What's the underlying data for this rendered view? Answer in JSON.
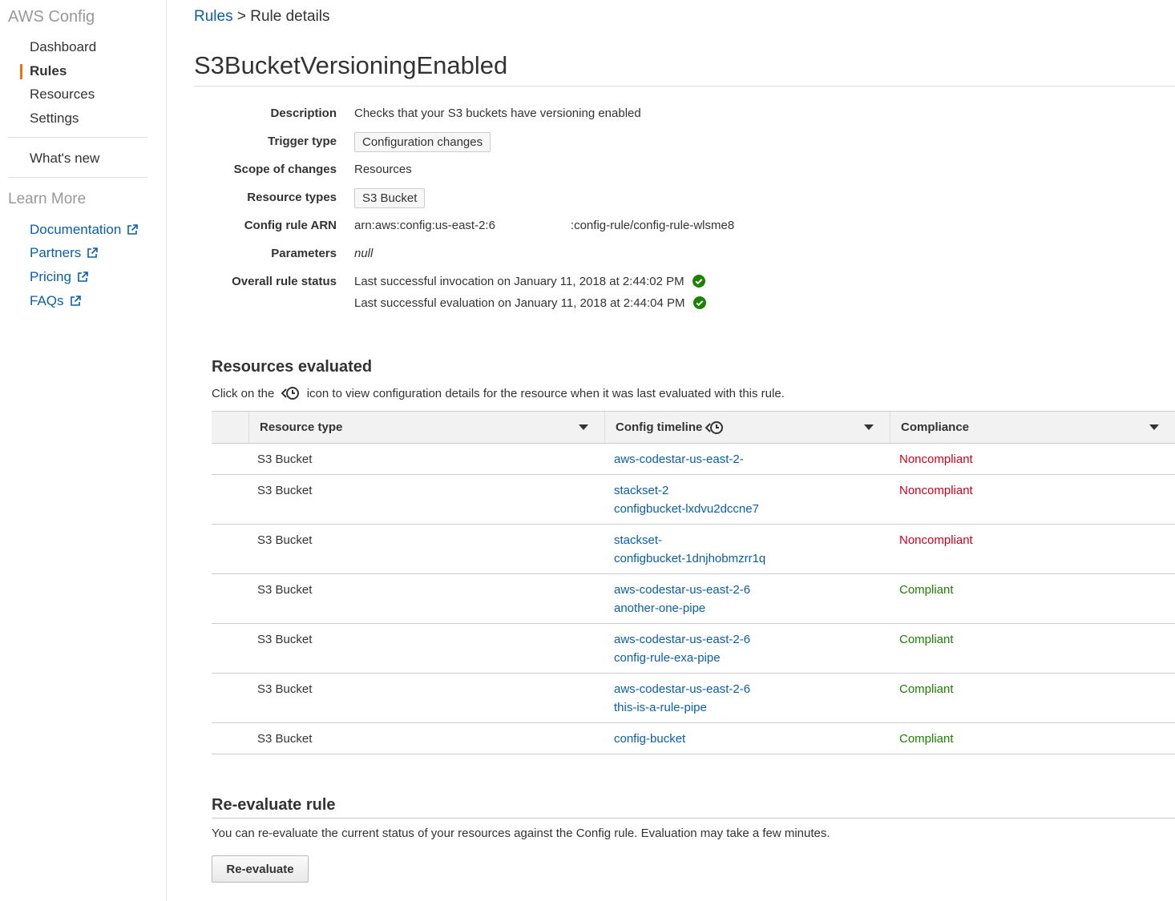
{
  "sidebar": {
    "title": "AWS Config",
    "nav": [
      {
        "label": "Dashboard",
        "active": false
      },
      {
        "label": "Rules",
        "active": true
      },
      {
        "label": "Resources",
        "active": false
      },
      {
        "label": "Settings",
        "active": false
      }
    ],
    "whats_new": "What's new",
    "learn_more_heading": "Learn More",
    "learn_links": [
      "Documentation",
      "Partners",
      "Pricing",
      "FAQs"
    ]
  },
  "breadcrumb": {
    "parent": "Rules",
    "separator": ">",
    "current": "Rule details"
  },
  "page_title": "S3BucketVersioningEnabled",
  "details": [
    {
      "label": "Description",
      "value": "Checks that your S3 buckets have versioning enabled"
    },
    {
      "label": "Trigger type",
      "value": "Configuration changes"
    },
    {
      "label": "Scope of changes",
      "value": "Resources"
    },
    {
      "label": "Resource types",
      "value": "S3 Bucket"
    },
    {
      "label": "Config rule ARN",
      "value": "arn:aws:config:us-east-2:6",
      "value_suffix": ":config-rule/config-rule-wlsme8"
    },
    {
      "label": "Parameters",
      "value": "null"
    },
    {
      "label": "Overall rule status",
      "value": "Last successful invocation on January 11, 2018 at 2:44:02 PM",
      "value2": "Last successful evaluation on January 11, 2018 at 2:44:04 PM"
    }
  ],
  "resources_section": {
    "title": "Resources evaluated",
    "desc_before": "Click on the",
    "desc_after": "icon to view configuration details for the resource when it was last evaluated with this rule.",
    "columns": [
      "Resource type",
      "Config timeline",
      "Compliance"
    ],
    "rows": [
      {
        "type": "S3 Bucket",
        "name": [
          "aws-codestar-us-east-2-"
        ],
        "compliance": "Noncompliant"
      },
      {
        "type": "S3 Bucket",
        "name": [
          "stackset-2",
          "configbucket-lxdvu2dccne7"
        ],
        "compliance": "Noncompliant"
      },
      {
        "type": "S3 Bucket",
        "name": [
          "stackset-",
          "configbucket-1dnjhobmzrr1q"
        ],
        "compliance": "Noncompliant"
      },
      {
        "type": "S3 Bucket",
        "name": [
          "aws-codestar-us-east-2-6",
          "another-one-pipe"
        ],
        "compliance": "Compliant"
      },
      {
        "type": "S3 Bucket",
        "name": [
          "aws-codestar-us-east-2-6",
          "config-rule-exa-pipe"
        ],
        "compliance": "Compliant"
      },
      {
        "type": "S3 Bucket",
        "name": [
          "aws-codestar-us-east-2-6",
          "this-is-a-rule-pipe"
        ],
        "compliance": "Compliant"
      },
      {
        "type": "S3 Bucket",
        "name": [
          "config-bucket"
        ],
        "compliance": "Compliant"
      }
    ]
  },
  "reevaluate_section": {
    "title": "Re-evaluate rule",
    "desc": "You can re-evaluate the current status of your resources against the Config rule. Evaluation may take a few minutes.",
    "button": "Re-evaluate"
  },
  "colors": {
    "accent": "#ec7211",
    "link": "#0b5ea8",
    "noncompliant": "#d0021b",
    "compliant": "#1d8102",
    "status_ok": "#1d8102"
  },
  "icons": {
    "external_link": "external-link-icon",
    "check": "check-circle-icon",
    "timeline": "config-timeline-icon",
    "sort": "caret-down-icon"
  }
}
